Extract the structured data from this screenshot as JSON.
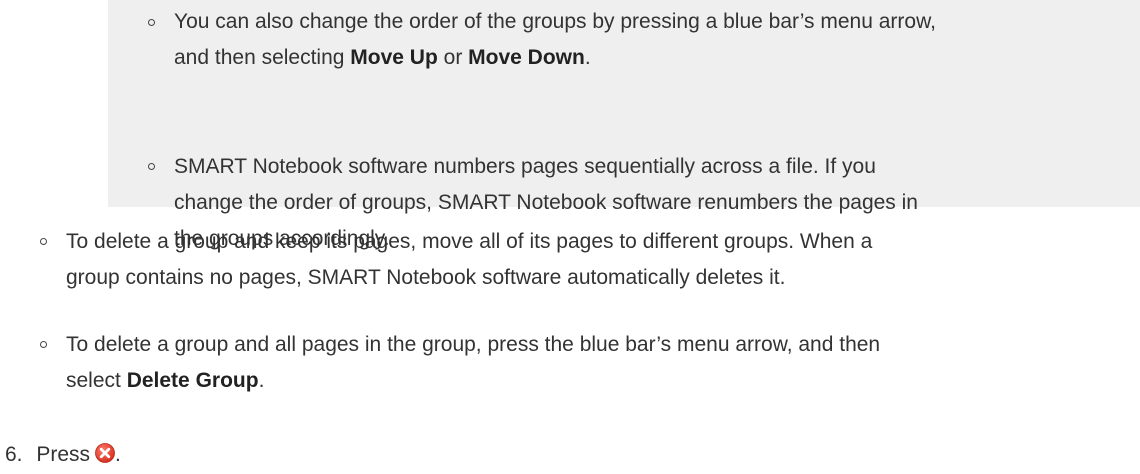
{
  "note_items": [
    {
      "lines": [
        [
          "You can also change the order of the groups by pressing a blue bar’s menu arrow,"
        ],
        [
          "and then selecting ",
          {
            "b": "Move Up"
          },
          " or ",
          {
            "b": "Move Down"
          },
          "."
        ]
      ]
    },
    {
      "lines": [
        [
          "SMART Notebook software numbers pages sequentially across a file. If you"
        ],
        [
          "change the order of groups, SMART Notebook software renumbers the pages in"
        ],
        [
          "the groups accordingly."
        ]
      ]
    }
  ],
  "sub_items": [
    {
      "lines": [
        [
          "To delete a group and keep its pages, move all of its pages to different groups. When a"
        ],
        [
          "group contains no pages, SMART Notebook software automatically deletes it."
        ]
      ]
    },
    {
      "lines": [
        [
          "To delete a group and all pages in the group, press the blue bar’s menu arrow, and then"
        ],
        [
          "select ",
          {
            "b": "Delete Group"
          },
          "."
        ]
      ]
    }
  ],
  "step6": {
    "number": "6.",
    "text": "Press",
    "icon": "close-icon",
    "after": ".",
    "icon_color": "#e0402f"
  }
}
